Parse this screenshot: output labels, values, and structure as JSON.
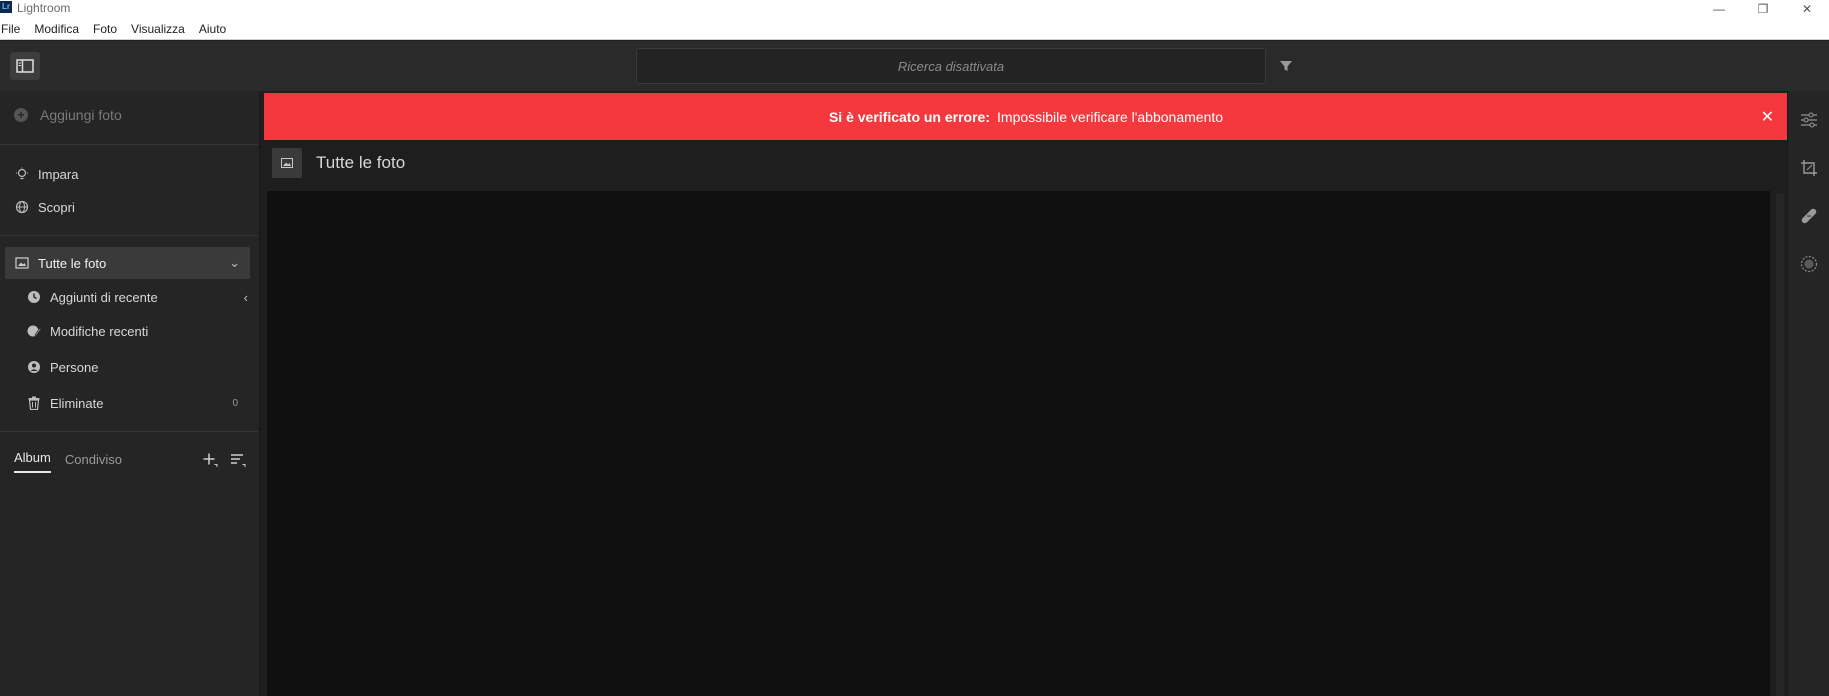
{
  "window": {
    "title": "Lightroom",
    "logo_text": "Lr",
    "controls": {
      "minimize": "—",
      "restore": "❐",
      "close": "✕"
    }
  },
  "menu": {
    "items": [
      "File",
      "Modifica",
      "Foto",
      "Visualizza",
      "Aiuto"
    ]
  },
  "toolbar": {
    "search_placeholder": "Ricerca disattivata",
    "filter_icon": "filter-icon",
    "panel_toggle_icon": "sidebar-toggle-icon"
  },
  "sidebar": {
    "add_photo_label": "Aggiungi foto",
    "items": [
      {
        "label": "Impara",
        "icon": "lightbulb-icon"
      },
      {
        "label": "Scopri",
        "icon": "globe-icon"
      }
    ],
    "library": {
      "selected": {
        "label": "Tutte le foto",
        "icon": "photo-icon"
      },
      "children": [
        {
          "label": "Aggiunti di recente",
          "icon": "clock-icon"
        },
        {
          "label": "Modifiche recenti",
          "icon": "edit-icon"
        },
        {
          "label": "Persone",
          "icon": "person-icon"
        },
        {
          "label": "Eliminate",
          "icon": "trash-icon",
          "count": "0"
        }
      ]
    },
    "tabs": [
      {
        "label": "Album",
        "active": true
      },
      {
        "label": "Condiviso",
        "active": false
      }
    ]
  },
  "main": {
    "error": {
      "heading": "Si è verificato un errore:",
      "message": "Impossibile verificare l'abbonamento",
      "background": "#f5383e"
    },
    "view_title": "Tutte le foto"
  },
  "rightrail": {
    "tools": [
      "sliders-icon",
      "crop-icon",
      "healing-icon",
      "mask-icon"
    ]
  }
}
